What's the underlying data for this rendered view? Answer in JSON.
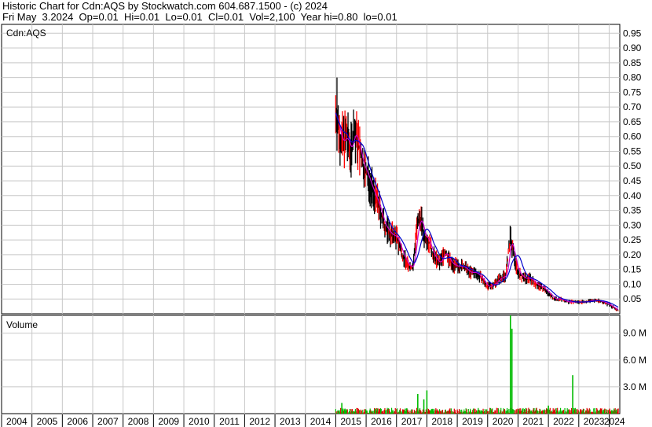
{
  "header": {
    "line1": "Historic Chart for Cdn:AQS by Stockwatch.com 604.687.1500 - (c) 2024",
    "line2": "Fri May  3.2024  Op=0.01  Hi=0.01  Lo=0.01  Cl=0.01  Vol=2,100  Year hi=0.80  lo=0.01"
  },
  "colors": {
    "price_bar": "#000000",
    "price_low": "#ff0000",
    "ma_short": "#cc00cc",
    "ma_long": "#0000cc",
    "vol_up": "#00bb00",
    "vol_down": "#dd0000",
    "grid": "#c8c8c8"
  },
  "chart_data": [
    {
      "type": "line",
      "title": "Cdn:AQS",
      "ylim": [
        0,
        0.98
      ],
      "y_ticks": [
        "0.95",
        "0.90",
        "0.85",
        "0.80",
        "0.75",
        "0.70",
        "0.65",
        "0.60",
        "0.55",
        "0.50",
        "0.45",
        "0.40",
        "0.35",
        "0.30",
        "0.25",
        "0.20",
        "0.15",
        "0.10",
        "0.05"
      ],
      "y_tick_values": [
        0.95,
        0.9,
        0.85,
        0.8,
        0.75,
        0.7,
        0.65,
        0.6,
        0.55,
        0.5,
        0.45,
        0.4,
        0.35,
        0.3,
        0.25,
        0.2,
        0.15,
        0.1,
        0.05
      ],
      "series": [
        {
          "x": [
            2015.0,
            2015.1,
            2015.2,
            2015.35,
            2015.5,
            2015.6,
            2015.75,
            2015.9,
            2016.0,
            2016.2,
            2016.4,
            2016.6,
            2016.8,
            2017.0,
            2017.2,
            2017.4,
            2017.55,
            2017.65,
            2017.8,
            2017.9,
            2018.0,
            2018.2,
            2018.4,
            2018.6,
            2018.8,
            2019.0,
            2019.2,
            2019.4,
            2019.6,
            2019.8,
            2020.0,
            2020.2,
            2020.4,
            2020.6,
            2020.7,
            2020.75,
            2020.85,
            2021.0,
            2021.2,
            2021.4,
            2021.6,
            2021.8,
            2022.0,
            2022.2,
            2022.4,
            2022.6,
            2022.8,
            2023.0,
            2023.2,
            2023.4,
            2023.6,
            2023.8,
            2024.0,
            2024.3
          ],
          "y": [
            0.68,
            0.62,
            0.58,
            0.6,
            0.55,
            0.62,
            0.57,
            0.5,
            0.48,
            0.42,
            0.37,
            0.3,
            0.27,
            0.26,
            0.2,
            0.16,
            0.16,
            0.28,
            0.33,
            0.26,
            0.26,
            0.2,
            0.17,
            0.21,
            0.17,
            0.16,
            0.16,
            0.14,
            0.14,
            0.12,
            0.09,
            0.1,
            0.12,
            0.13,
            0.22,
            0.26,
            0.2,
            0.14,
            0.12,
            0.12,
            0.1,
            0.09,
            0.07,
            0.05,
            0.05,
            0.04,
            0.04,
            0.04,
            0.04,
            0.045,
            0.045,
            0.04,
            0.03,
            0.01
          ]
        }
      ],
      "high": 0.8
    },
    {
      "type": "bar",
      "title": "Volume",
      "ylim": [
        0,
        11.0
      ],
      "y_ticks": [
        "9.0 M",
        "6.0 M",
        "3.0 M"
      ],
      "y_tick_values": [
        9.0,
        6.0,
        3.0
      ],
      "unit": "M",
      "spikes": [
        {
          "x": 2015.2,
          "v": 1.2
        },
        {
          "x": 2017.7,
          "v": 2.2
        },
        {
          "x": 2017.9,
          "v": 1.6
        },
        {
          "x": 2018.0,
          "v": 2.6
        },
        {
          "x": 2020.75,
          "v": 11.0
        },
        {
          "x": 2020.8,
          "v": 9.5
        },
        {
          "x": 2022.0,
          "v": 0.9
        },
        {
          "x": 2022.8,
          "v": 4.3
        }
      ]
    }
  ],
  "x_axis": {
    "labels": [
      "2004",
      "2005",
      "2006",
      "2007",
      "2008",
      "2009",
      "2010",
      "2011",
      "2012",
      "2013",
      "2014",
      "2015",
      "2016",
      "2017",
      "2018",
      "2019",
      "2020",
      "2021",
      "2022",
      "2023",
      "2024"
    ],
    "range": [
      2004.0,
      2024.35
    ]
  }
}
